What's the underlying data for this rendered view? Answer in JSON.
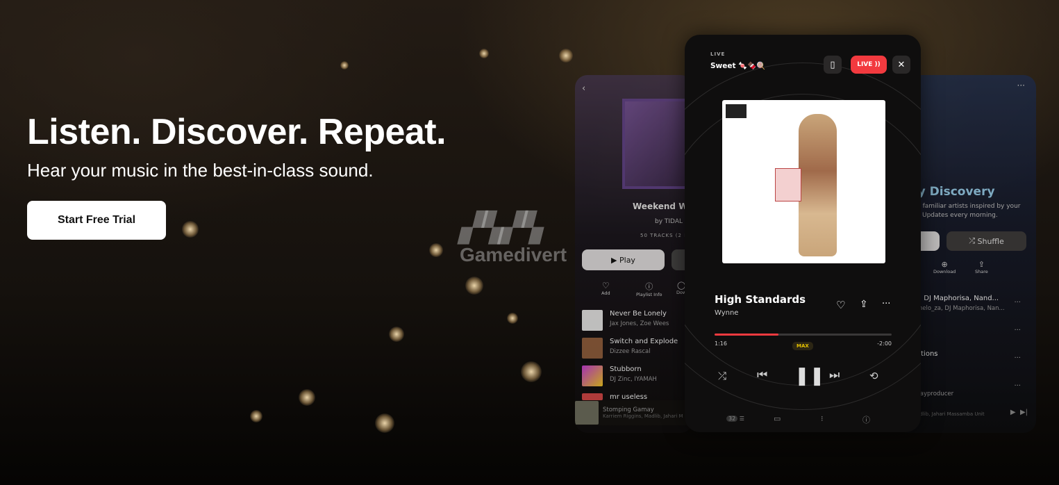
{
  "hero": {
    "title": "Listen. Discover. Repeat.",
    "subtitle": "Hear your music in the best-in-class sound.",
    "cta": "Start Free Trial"
  },
  "watermark": {
    "logo": "Gamedivert",
    "text": "Gamedivert"
  },
  "left_phone": {
    "playlist_title": "Weekend W",
    "by": "by TIDAL",
    "meta": "50 TRACKS (2 HO",
    "play": "Play",
    "actions": [
      "Add",
      "Playlist Info",
      "Dow"
    ],
    "tracks": [
      {
        "title": "Never Be Lonely",
        "artist": "Jax Jones, Zoe Wees"
      },
      {
        "title": "Switch and Explode",
        "artist": "Dizzee Rascal"
      },
      {
        "title": "Stubborn",
        "artist": "DJ Zinc, IYAMAH"
      },
      {
        "title": "mr useless",
        "artist": ""
      }
    ],
    "mini_player": {
      "title": "Stomping Gamay",
      "artist": "Karriem Riggins, Madlib, Jahari M"
    }
  },
  "center_phone": {
    "live_label": "LIVE",
    "session": "Sweet 🍬🍫🍭",
    "live_button": "LIVE",
    "song": "High Standards",
    "artist": "Wynne",
    "elapsed": "1:16",
    "remaining": "-2:00",
    "progress_percent": 36,
    "quality": "MAX",
    "queue_count": "32",
    "accent": "#f23a3f",
    "quality_color": "#e6c200"
  },
  "right_phone": {
    "title": "ily Discovery",
    "desc1": "d familiar artists inspired by your",
    "desc2": "Updates every morning.",
    "shuffle": "Shuffle",
    "actions": [
      "Download",
      "Share"
    ],
    "tracks": [
      {
        "title": "t. DJ Maphorisa, Nand...",
        "artist": "melo_za, DJ Maphorisa, Nan..."
      },
      {
        "title": "",
        "artist": ""
      },
      {
        "title": "ations",
        "artist": ""
      },
      {
        "title": "",
        "artist": "kayproducer"
      }
    ],
    "mini_player": {
      "title": "ay",
      "artist": "Madlib, Jahari Massamba Unit"
    }
  }
}
